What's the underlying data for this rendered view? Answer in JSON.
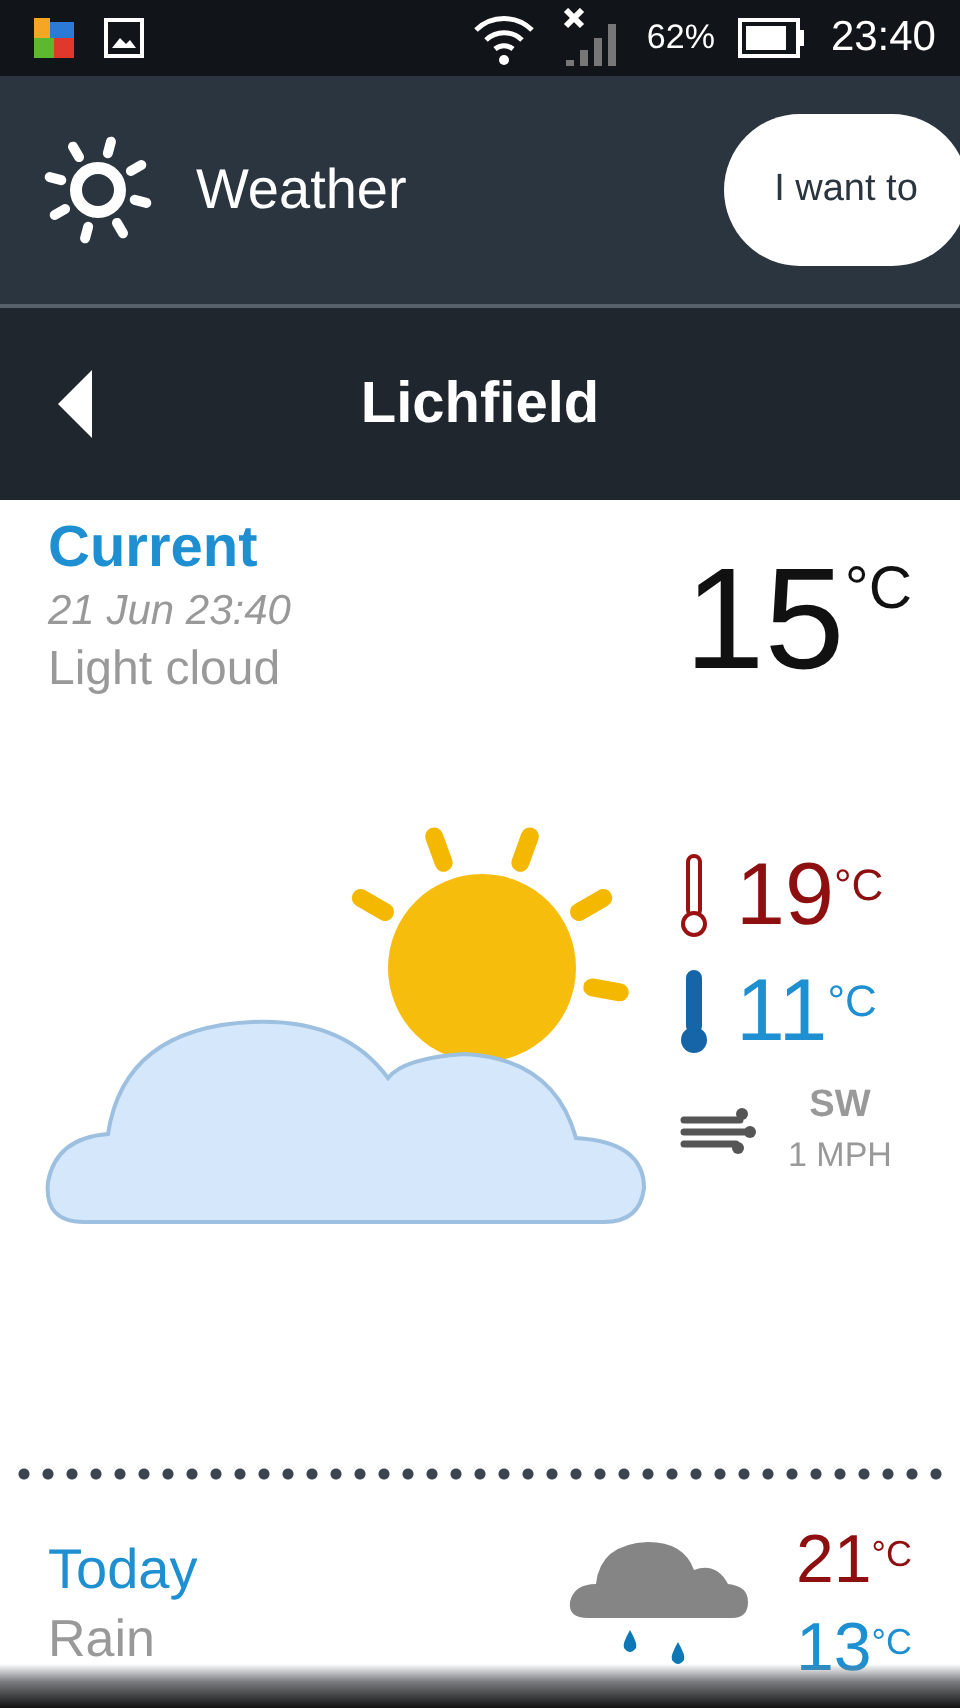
{
  "status_bar": {
    "battery": "62%",
    "time": "23:40"
  },
  "app_bar": {
    "title": "Weather",
    "action": "I want to"
  },
  "location_bar": {
    "title": "Lichfield"
  },
  "current": {
    "heading": "Current",
    "datetime": "21 Jun 23:40",
    "condition": "Light cloud",
    "temperature": "15",
    "unit": "°C",
    "high": {
      "value": "19",
      "unit": "°C"
    },
    "low": {
      "value": "11",
      "unit": "°C"
    },
    "wind_direction": "SW",
    "wind_speed": "1 MPH"
  },
  "forecast": [
    {
      "day": "Today",
      "condition": "Rain",
      "high": "21",
      "high_unit": "°C",
      "low": "13",
      "low_unit": "°C"
    }
  ]
}
